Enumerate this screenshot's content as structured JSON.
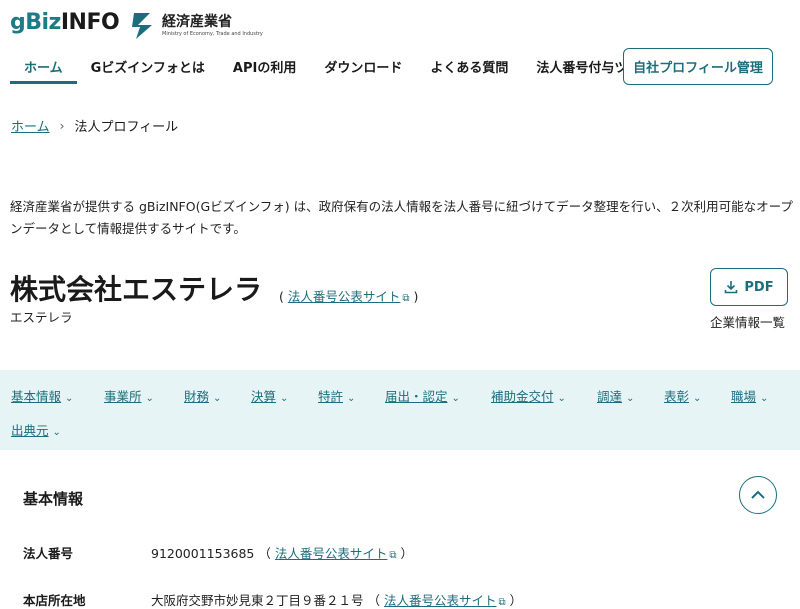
{
  "header": {
    "logo_g": "g",
    "logo_biz": "Biz",
    "logo_info": "INFO",
    "meti_ja": "経済産業省",
    "meti_en": "Ministry of Economy, Trade and Industry",
    "nav": [
      {
        "label": "ホーム",
        "active": true
      },
      {
        "label": "Gビズインフォとは",
        "active": false
      },
      {
        "label": "APIの利用",
        "active": false
      },
      {
        "label": "ダウンロード",
        "active": false
      },
      {
        "label": "よくある質問",
        "active": false
      },
      {
        "label": "法人番号付与ツール",
        "active": false
      }
    ],
    "profile_button": "自社プロフィール管理"
  },
  "breadcrumb": {
    "home": "ホーム",
    "separator": "›",
    "current": "法人プロフィール"
  },
  "description": "経済産業省が提供する gBizINFO(Gビズインフォ) は、政府保有の法人情報を法人番号に紐づけてデータ整理を行い、２次利用可能なオープンデータとして情報提供するサイトです。",
  "company": {
    "name": "株式会社エステレラ",
    "kana": "エステレラ",
    "link_open": "(",
    "link_label": "法人番号公表サイト",
    "link_close": ")",
    "pdf_label": "PDF",
    "pdf_caption": "企業情報一覧"
  },
  "tabs": [
    "基本情報",
    "事業所",
    "財務",
    "決算",
    "特許",
    "届出・認定",
    "補助金交付",
    "調達",
    "表彰",
    "職場",
    "出典元"
  ],
  "section": {
    "title": "基本情報",
    "rows": [
      {
        "label": "法人番号",
        "value": "9120001153685",
        "link_open": "（",
        "link": "法人番号公表サイト",
        "link_close": "）"
      },
      {
        "label": "本店所在地",
        "value": "大阪府交野市妙見東２丁目９番２１号",
        "link_open": "（",
        "link": "法人番号公表サイト",
        "link_close": "）"
      }
    ]
  },
  "colors": {
    "accent": "#1d6e7b",
    "tabbar_bg": "#e6f4f5"
  }
}
